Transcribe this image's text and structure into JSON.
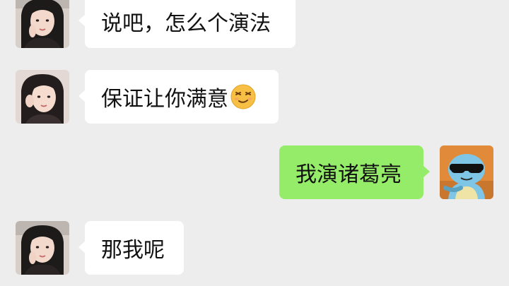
{
  "conversation": {
    "messages": [
      {
        "sender": "contact",
        "text": "说吧，怎么个演法"
      },
      {
        "sender": "contact",
        "text": "保证让你满意",
        "emoji": "smirking-face-emoji"
      },
      {
        "sender": "self",
        "text": "我演诸葛亮"
      },
      {
        "sender": "contact",
        "text": "那我呢"
      }
    ]
  },
  "colors": {
    "background": "#ededed",
    "incoming_bubble": "#ffffff",
    "outgoing_bubble": "#95ec69"
  },
  "icons": {
    "contact_avatar": "girl-avatar-photo",
    "self_avatar": "squirtle-sunglasses-avatar"
  }
}
